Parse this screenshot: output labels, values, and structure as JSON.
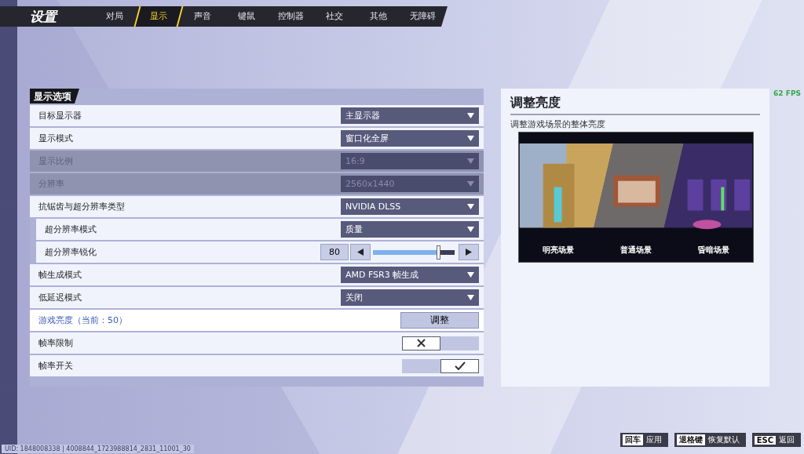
{
  "header": {
    "title": "设置",
    "tabs": [
      {
        "label": "对局",
        "selected": false
      },
      {
        "label": "显示",
        "selected": true
      },
      {
        "label": "声音",
        "selected": false
      },
      {
        "label": "键鼠",
        "selected": false
      },
      {
        "label": "控制器",
        "selected": false
      },
      {
        "label": "社交",
        "selected": false
      },
      {
        "label": "其他",
        "selected": false
      },
      {
        "label": "无障碍",
        "selected": false
      }
    ]
  },
  "settings": {
    "title": "显示选项",
    "rows": [
      {
        "kind": "dropdown",
        "label": "目标显示器",
        "value": "主显示器",
        "disabled": false,
        "selected": false
      },
      {
        "kind": "dropdown",
        "label": "显示模式",
        "value": "窗口化全屏",
        "disabled": false,
        "selected": false
      },
      {
        "kind": "dropdown",
        "label": "显示比例",
        "value": "16:9",
        "disabled": true,
        "selected": false
      },
      {
        "kind": "dropdown",
        "label": "分辨率",
        "value": "2560x1440",
        "disabled": true,
        "selected": false
      },
      {
        "kind": "dropdown",
        "label": "抗锯齿与超分辨率类型",
        "value": "NVIDIA DLSS",
        "disabled": false,
        "selected": false,
        "children": [
          {
            "kind": "dropdown",
            "label": "超分辨率模式",
            "value": "质量",
            "disabled": false,
            "selected": false
          },
          {
            "kind": "slider",
            "label": "超分辨率锐化",
            "value": "80",
            "level": 0.8,
            "disabled": false,
            "selected": false
          }
        ]
      },
      {
        "kind": "dropdown",
        "label": "帧生成模式",
        "value": "AMD FSR3 帧生成",
        "disabled": false,
        "selected": false
      },
      {
        "kind": "dropdown",
        "label": "低延迟模式",
        "value": "关闭",
        "disabled": false,
        "selected": false
      },
      {
        "kind": "button",
        "label": "游戏亮度（当前：50）",
        "button": "调整",
        "disabled": false,
        "selected": true
      },
      {
        "kind": "toggle",
        "label": "帧率限制",
        "on": false,
        "disabled": false,
        "selected": false
      },
      {
        "kind": "toggle",
        "label": "帧率开关",
        "on": true,
        "disabled": false,
        "selected": false
      }
    ]
  },
  "detail": {
    "title": "调整亮度",
    "description": "调整游戏场景的整体亮度",
    "captions": [
      "明亮场景",
      "普通场景",
      "昏暗场景"
    ]
  },
  "fps": "62 FPS",
  "footer": {
    "uid": "UID: 1848008338 | 4008844_1723988814_2831_11001_30",
    "hints": [
      {
        "key": "回车",
        "action": "应用"
      },
      {
        "key": "退格键",
        "action": "恢复默认"
      },
      {
        "key": "ESC",
        "action": "返回"
      }
    ]
  }
}
